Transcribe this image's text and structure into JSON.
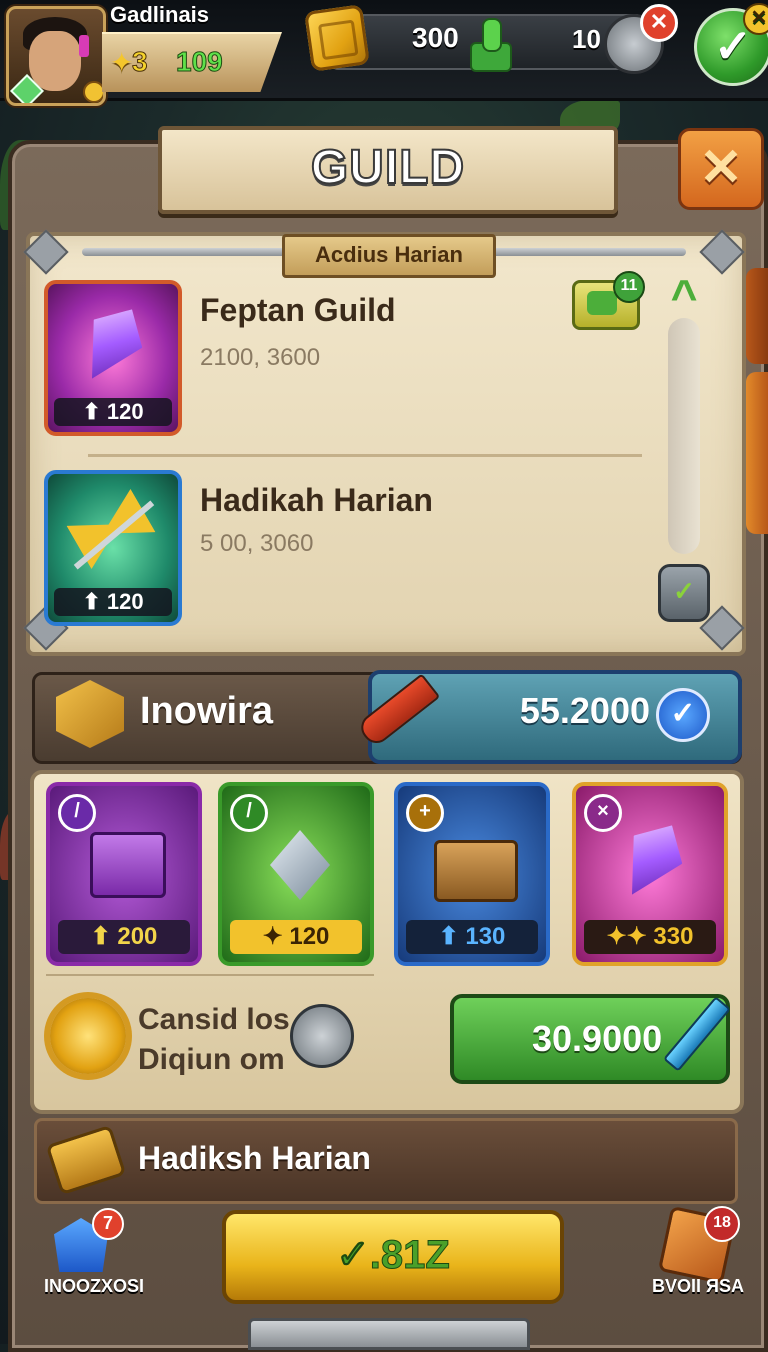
{
  "player": {
    "name": "Gadlinais",
    "level": "3",
    "xp": "109"
  },
  "currencies": {
    "gold": "300",
    "tokens": "10"
  },
  "header": {
    "title": "GUILD",
    "close": "✕",
    "confirm": "✓"
  },
  "quest_section": {
    "banner": "Acdius Harian",
    "badge_count": "11",
    "quests": [
      {
        "title": "Feptan Guild",
        "subtitle": "2100, 3600",
        "reward": "120"
      },
      {
        "title": "Hadikah Harian",
        "subtitle": "5 00, 3060",
        "reward": "120"
      }
    ],
    "scroll_up": "^",
    "scroll_thumb": "✓"
  },
  "resource_bar": {
    "label": "Inowira",
    "value": "55.2000",
    "check": "✓"
  },
  "rewards": [
    {
      "value": "200",
      "corner": "/"
    },
    {
      "value": "120",
      "corner": "/"
    },
    {
      "value": "130",
      "corner": "+"
    },
    {
      "value": "330",
      "corner": "×"
    }
  ],
  "buff": {
    "line1": "Cansid los",
    "line2": "Diqiun om",
    "button_value": "30.9000"
  },
  "bottom_strip": {
    "label": "Hadiksh Harian"
  },
  "footer": {
    "left_label": "INOOZXOSI",
    "left_badge": "7",
    "main_button": "✓.81Z",
    "right_label": "BVOII ЯSA",
    "right_badge": "18"
  },
  "colors": {
    "panel": "#5c4d40",
    "paper": "#f2e7cc",
    "accent_green": "#3ea83a",
    "accent_gold": "#e9b41a"
  }
}
